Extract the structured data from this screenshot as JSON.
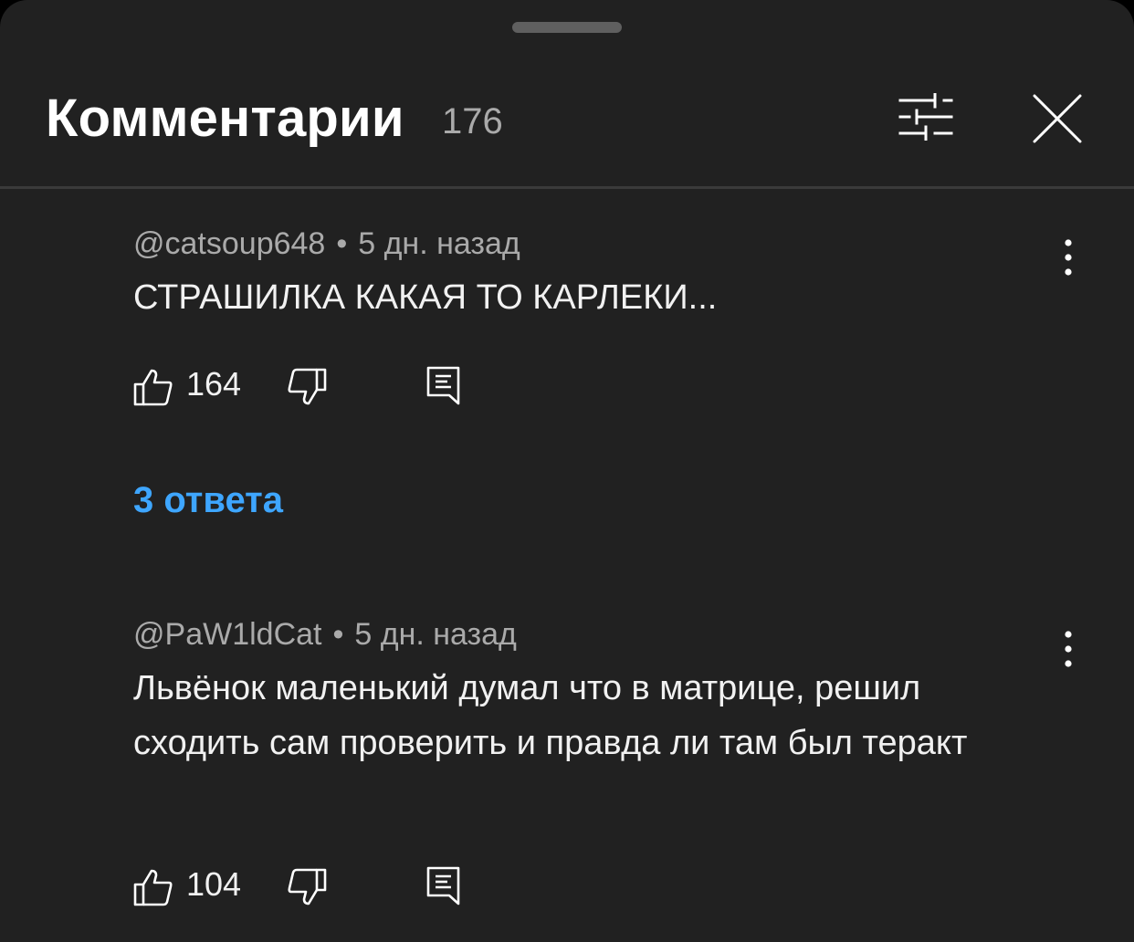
{
  "header": {
    "title": "Комментарии",
    "count": "176",
    "filter_icon": "sliders-icon",
    "close_icon": "close-icon"
  },
  "comments": [
    {
      "author": "@catsoup648",
      "separator": "•",
      "time": "5 дн. назад",
      "text": "СТРАШИЛКА КАКАЯ ТО КАРЛЕКИ...",
      "likes": "164",
      "replies_label": "3 ответа"
    },
    {
      "author": "@PaW1ldCat",
      "separator": "•",
      "time": "5 дн. назад",
      "text": "Львёнок маленький думал что в матрице, решил сходить сам проверить и правда ли там был теракт",
      "likes": "104"
    }
  ],
  "colors": {
    "background": "#212121",
    "link": "#3ea6ff",
    "secondary_text": "#aaaaaa",
    "primary_text": "#f1f1f1"
  }
}
